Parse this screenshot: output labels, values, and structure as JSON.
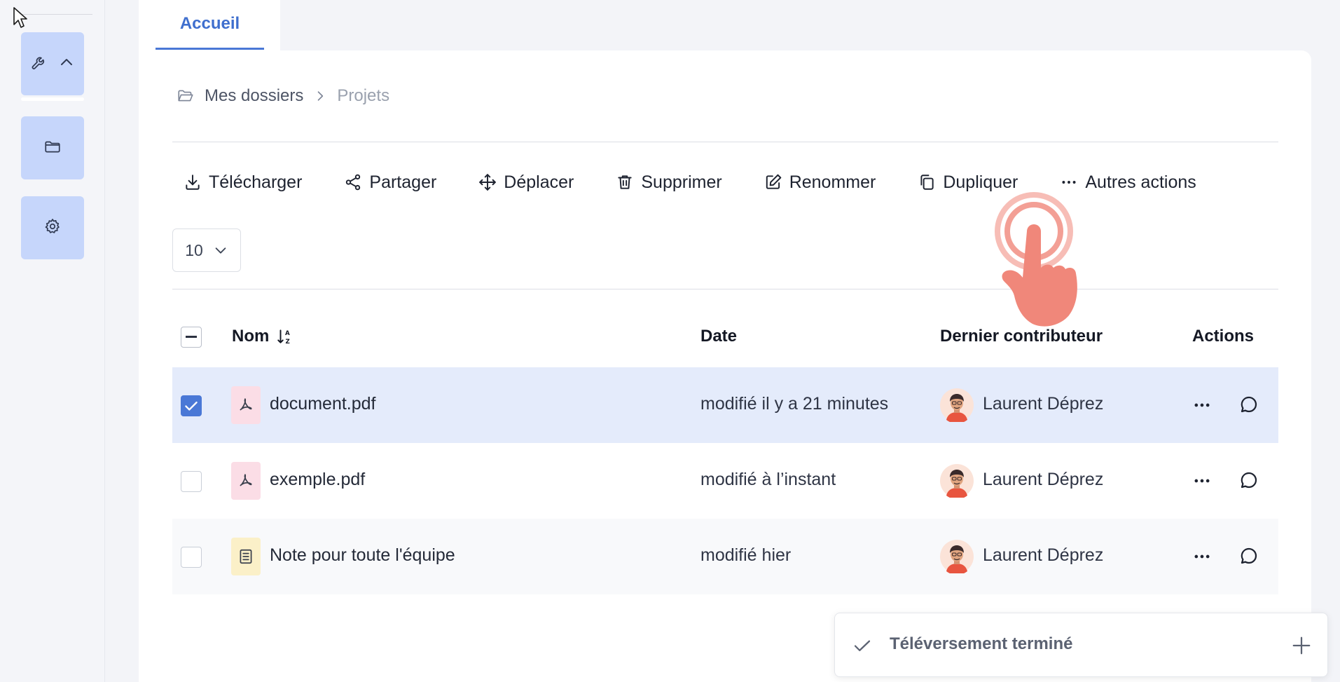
{
  "sidebar": {
    "items": [
      {
        "name": "tools",
        "icon": "wrench-icon"
      },
      {
        "name": "folders",
        "icon": "folder-icon"
      },
      {
        "name": "settings",
        "icon": "gear-icon"
      }
    ]
  },
  "tabs": [
    {
      "label": "Accueil",
      "active": true
    }
  ],
  "breadcrumb": {
    "root": "Mes dossiers",
    "current": "Projets"
  },
  "toolbar": {
    "download": "Télécharger",
    "share": "Partager",
    "move": "Déplacer",
    "delete": "Supprimer",
    "rename": "Renommer",
    "duplicate": "Dupliquer",
    "more": "Autres actions"
  },
  "pagination": {
    "page_size": "10"
  },
  "table": {
    "headers": {
      "name": "Nom",
      "date": "Date",
      "contributor": "Dernier contributeur",
      "actions": "Actions"
    },
    "rows": [
      {
        "name": "document.pdf",
        "type": "pdf",
        "date": "modifié il y a 21 minutes",
        "contributor": "Laurent Déprez",
        "selected": true
      },
      {
        "name": "exemple.pdf",
        "type": "pdf",
        "date": "modifié à l’instant",
        "contributor": "Laurent Déprez",
        "selected": false
      },
      {
        "name": "Note pour toute l'équipe",
        "type": "note",
        "date": "modifié hier",
        "contributor": "Laurent Déprez",
        "selected": false
      }
    ]
  },
  "toast": {
    "message": "Téléversement terminé"
  },
  "colors": {
    "accent": "#4a78d6",
    "sidebar_button": "#c6d6fb",
    "selected_row": "#e4ebfb",
    "pdf_icon_bg": "#fbdde6",
    "note_icon_bg": "#fbf0c8",
    "tap_indicator": "#f0877a"
  }
}
